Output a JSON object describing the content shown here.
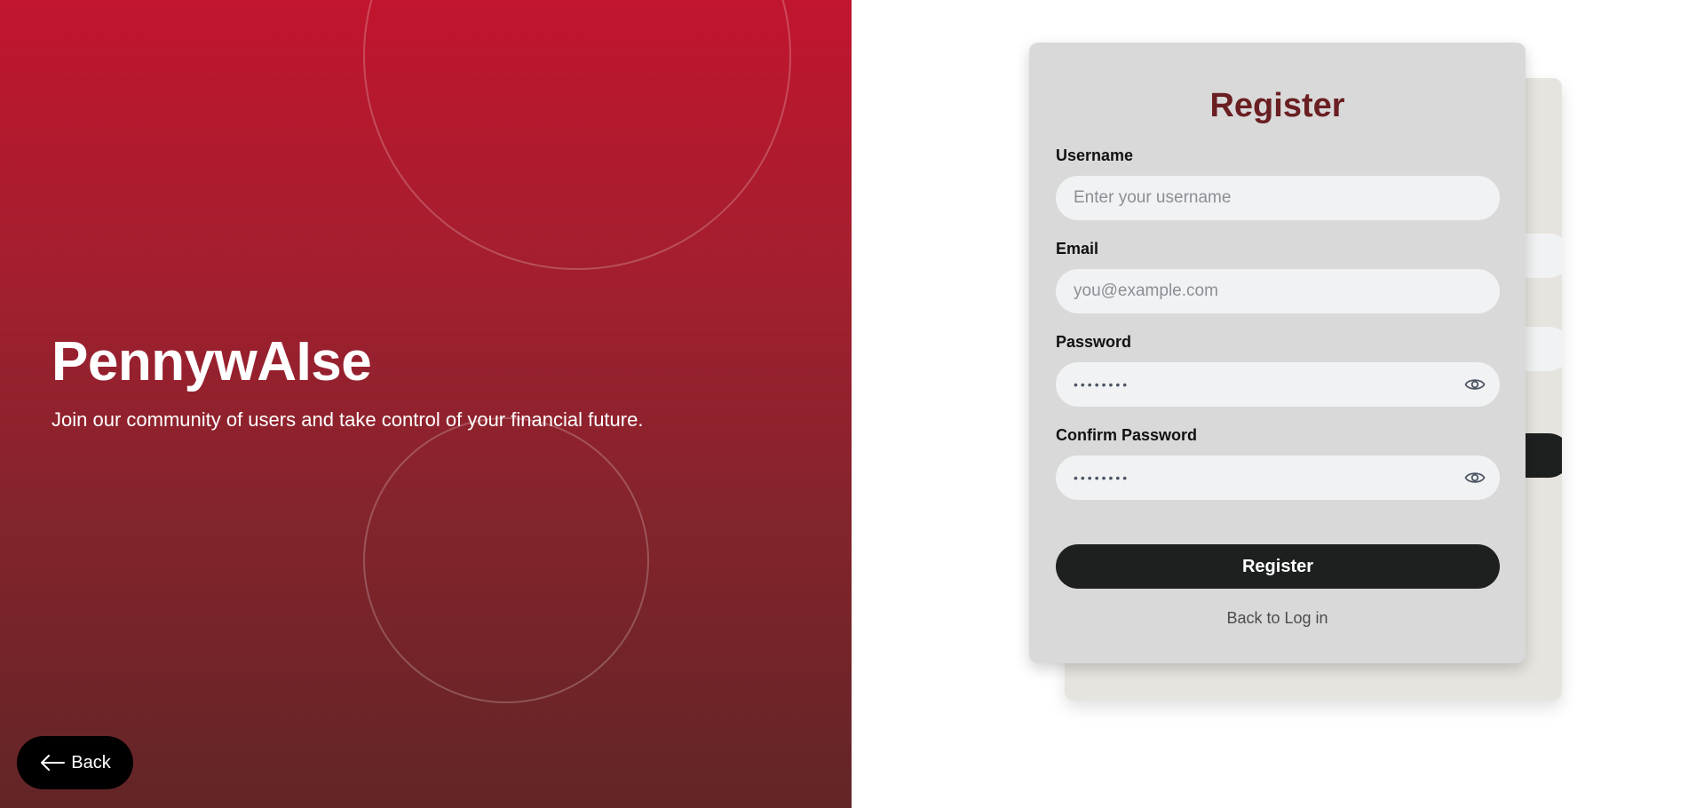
{
  "hero": {
    "brand": "PennywAIse",
    "tagline": "Join our community of users and take control of your financial future.",
    "back_label": "Back"
  },
  "form": {
    "title": "Register",
    "username": {
      "label": "Username",
      "placeholder": "Enter your username"
    },
    "email": {
      "label": "Email",
      "placeholder": "you@example.com"
    },
    "password": {
      "label": "Password",
      "masked_value": "••••••••"
    },
    "confirm_password": {
      "label": "Confirm Password",
      "masked_value": "••••••••"
    },
    "submit_label": "Register",
    "login_link": "Back to Log in"
  },
  "colors": {
    "hero_top": "#c1152e",
    "hero_bottom": "#622527",
    "card_bg": "#d9d9d9",
    "title": "#6a1f22",
    "button": "#1d201f"
  },
  "icons": {
    "back": "arrow-left-icon",
    "password_toggle": "eye-icon"
  }
}
